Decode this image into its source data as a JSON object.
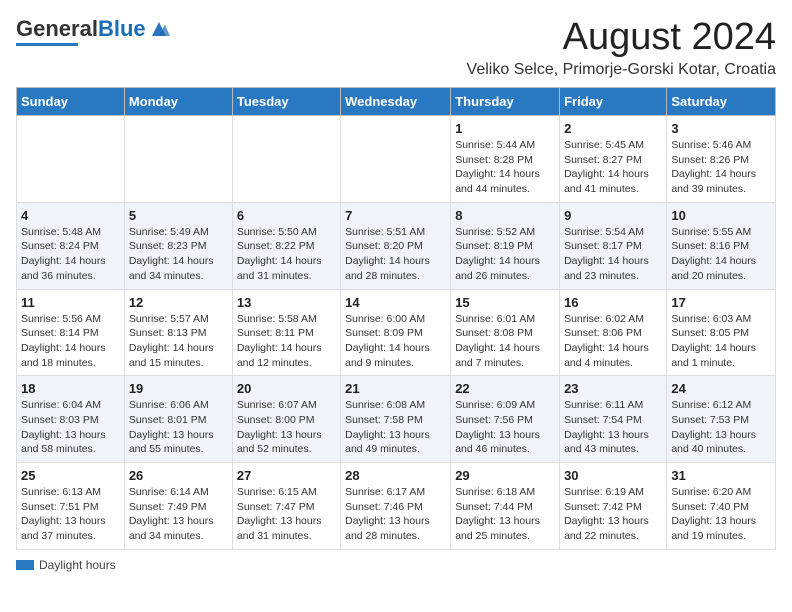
{
  "header": {
    "logo_general": "General",
    "logo_blue": "Blue",
    "month_title": "August 2024",
    "location": "Veliko Selce, Primorje-Gorski Kotar, Croatia"
  },
  "days_of_week": [
    "Sunday",
    "Monday",
    "Tuesday",
    "Wednesday",
    "Thursday",
    "Friday",
    "Saturday"
  ],
  "weeks": [
    [
      {
        "day": "",
        "info": ""
      },
      {
        "day": "",
        "info": ""
      },
      {
        "day": "",
        "info": ""
      },
      {
        "day": "",
        "info": ""
      },
      {
        "day": "1",
        "info": "Sunrise: 5:44 AM\nSunset: 8:28 PM\nDaylight: 14 hours and 44 minutes."
      },
      {
        "day": "2",
        "info": "Sunrise: 5:45 AM\nSunset: 8:27 PM\nDaylight: 14 hours and 41 minutes."
      },
      {
        "day": "3",
        "info": "Sunrise: 5:46 AM\nSunset: 8:26 PM\nDaylight: 14 hours and 39 minutes."
      }
    ],
    [
      {
        "day": "4",
        "info": "Sunrise: 5:48 AM\nSunset: 8:24 PM\nDaylight: 14 hours and 36 minutes."
      },
      {
        "day": "5",
        "info": "Sunrise: 5:49 AM\nSunset: 8:23 PM\nDaylight: 14 hours and 34 minutes."
      },
      {
        "day": "6",
        "info": "Sunrise: 5:50 AM\nSunset: 8:22 PM\nDaylight: 14 hours and 31 minutes."
      },
      {
        "day": "7",
        "info": "Sunrise: 5:51 AM\nSunset: 8:20 PM\nDaylight: 14 hours and 28 minutes."
      },
      {
        "day": "8",
        "info": "Sunrise: 5:52 AM\nSunset: 8:19 PM\nDaylight: 14 hours and 26 minutes."
      },
      {
        "day": "9",
        "info": "Sunrise: 5:54 AM\nSunset: 8:17 PM\nDaylight: 14 hours and 23 minutes."
      },
      {
        "day": "10",
        "info": "Sunrise: 5:55 AM\nSunset: 8:16 PM\nDaylight: 14 hours and 20 minutes."
      }
    ],
    [
      {
        "day": "11",
        "info": "Sunrise: 5:56 AM\nSunset: 8:14 PM\nDaylight: 14 hours and 18 minutes."
      },
      {
        "day": "12",
        "info": "Sunrise: 5:57 AM\nSunset: 8:13 PM\nDaylight: 14 hours and 15 minutes."
      },
      {
        "day": "13",
        "info": "Sunrise: 5:58 AM\nSunset: 8:11 PM\nDaylight: 14 hours and 12 minutes."
      },
      {
        "day": "14",
        "info": "Sunrise: 6:00 AM\nSunset: 8:09 PM\nDaylight: 14 hours and 9 minutes."
      },
      {
        "day": "15",
        "info": "Sunrise: 6:01 AM\nSunset: 8:08 PM\nDaylight: 14 hours and 7 minutes."
      },
      {
        "day": "16",
        "info": "Sunrise: 6:02 AM\nSunset: 8:06 PM\nDaylight: 14 hours and 4 minutes."
      },
      {
        "day": "17",
        "info": "Sunrise: 6:03 AM\nSunset: 8:05 PM\nDaylight: 14 hours and 1 minute."
      }
    ],
    [
      {
        "day": "18",
        "info": "Sunrise: 6:04 AM\nSunset: 8:03 PM\nDaylight: 13 hours and 58 minutes."
      },
      {
        "day": "19",
        "info": "Sunrise: 6:06 AM\nSunset: 8:01 PM\nDaylight: 13 hours and 55 minutes."
      },
      {
        "day": "20",
        "info": "Sunrise: 6:07 AM\nSunset: 8:00 PM\nDaylight: 13 hours and 52 minutes."
      },
      {
        "day": "21",
        "info": "Sunrise: 6:08 AM\nSunset: 7:58 PM\nDaylight: 13 hours and 49 minutes."
      },
      {
        "day": "22",
        "info": "Sunrise: 6:09 AM\nSunset: 7:56 PM\nDaylight: 13 hours and 46 minutes."
      },
      {
        "day": "23",
        "info": "Sunrise: 6:11 AM\nSunset: 7:54 PM\nDaylight: 13 hours and 43 minutes."
      },
      {
        "day": "24",
        "info": "Sunrise: 6:12 AM\nSunset: 7:53 PM\nDaylight: 13 hours and 40 minutes."
      }
    ],
    [
      {
        "day": "25",
        "info": "Sunrise: 6:13 AM\nSunset: 7:51 PM\nDaylight: 13 hours and 37 minutes."
      },
      {
        "day": "26",
        "info": "Sunrise: 6:14 AM\nSunset: 7:49 PM\nDaylight: 13 hours and 34 minutes."
      },
      {
        "day": "27",
        "info": "Sunrise: 6:15 AM\nSunset: 7:47 PM\nDaylight: 13 hours and 31 minutes."
      },
      {
        "day": "28",
        "info": "Sunrise: 6:17 AM\nSunset: 7:46 PM\nDaylight: 13 hours and 28 minutes."
      },
      {
        "day": "29",
        "info": "Sunrise: 6:18 AM\nSunset: 7:44 PM\nDaylight: 13 hours and 25 minutes."
      },
      {
        "day": "30",
        "info": "Sunrise: 6:19 AM\nSunset: 7:42 PM\nDaylight: 13 hours and 22 minutes."
      },
      {
        "day": "31",
        "info": "Sunrise: 6:20 AM\nSunset: 7:40 PM\nDaylight: 13 hours and 19 minutes."
      }
    ]
  ],
  "footer": {
    "daylight_label": "Daylight hours"
  }
}
